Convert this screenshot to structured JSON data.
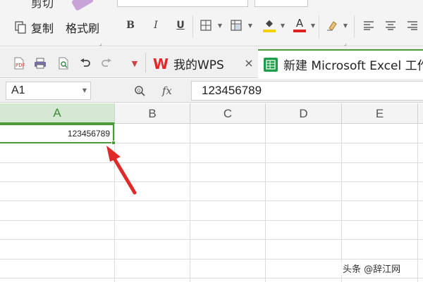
{
  "ribbon": {
    "cut_label": "剪切",
    "copy_label": "复制",
    "format_painter_label": "格式刷",
    "bold": "B",
    "italic": "I",
    "underline": "U",
    "corner": "⌟",
    "icons": [
      "copy-icon",
      "border-icon",
      "merge-icon",
      "fill-color-icon",
      "font-color-icon",
      "clear-format-icon",
      "align-left-icon",
      "align-center-icon",
      "align-right-icon"
    ]
  },
  "toolbar": {
    "tabs": [
      {
        "label": "我的WPS",
        "closable": true
      },
      {
        "label": "新建 Microsoft Excel 工作表",
        "active": true
      }
    ],
    "close_glyph": "×"
  },
  "formula_bar": {
    "name_box": "A1",
    "fx": "fx",
    "value": "123456789"
  },
  "sheet": {
    "columns": [
      "A",
      "B",
      "C",
      "D",
      "E"
    ],
    "selected_column": "A",
    "selected_cell": "A1",
    "cells": {
      "A1": "123456789"
    }
  },
  "colors": {
    "accent_green": "#4a9a3a",
    "selected_header_bg": "#d5e8d4",
    "annotation_arrow": "#e02a2a",
    "fill_color": "#f5d100",
    "font_color": "#e02020"
  },
  "watermark": "头条 @辞江网"
}
